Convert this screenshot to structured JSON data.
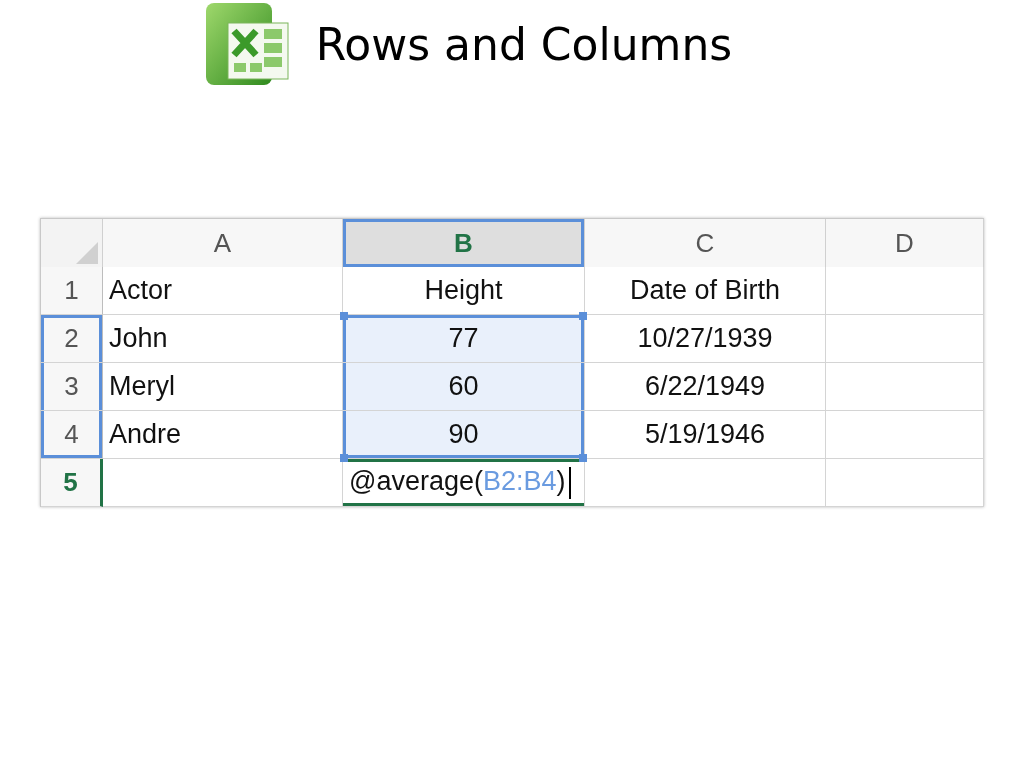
{
  "title": "Rows and Columns",
  "spreadsheet": {
    "columns": [
      {
        "label": "A",
        "selected": false
      },
      {
        "label": "B",
        "selected": true
      },
      {
        "label": "C",
        "selected": false
      },
      {
        "label": "D",
        "selected": false
      }
    ],
    "rows": [
      {
        "number": "1",
        "active": false,
        "outlined": false,
        "cells": [
          {
            "text": "Actor",
            "in_range": false
          },
          {
            "text": "Height",
            "in_range": false
          },
          {
            "text": "Date of Birth",
            "in_range": false
          },
          {
            "in_range": false
          }
        ]
      },
      {
        "number": "2",
        "active": false,
        "outlined": true,
        "cells": [
          {
            "text": "John",
            "in_range": false
          },
          {
            "text": "77",
            "in_range": true
          },
          {
            "text": "10/27/1939",
            "in_range": false
          },
          {
            "in_range": false
          }
        ]
      },
      {
        "number": "3",
        "active": false,
        "outlined": true,
        "cells": [
          {
            "text": "Meryl",
            "in_range": false
          },
          {
            "text": "60",
            "in_range": true
          },
          {
            "text": "6/22/1949",
            "in_range": false
          },
          {
            "in_range": false
          }
        ]
      },
      {
        "number": "4",
        "active": false,
        "outlined": true,
        "cells": [
          {
            "text": "Andre",
            "in_range": false
          },
          {
            "text": "90",
            "in_range": true
          },
          {
            "text": "5/19/1946",
            "in_range": false
          },
          {
            "in_range": false
          }
        ]
      },
      {
        "number": "5",
        "active": true,
        "outlined": false,
        "cells": [
          {
            "in_range": false
          },
          {
            "kind": "formula",
            "prefix": "@average(",
            "reference": "B2:B4",
            "suffix": ")",
            "in_range": false
          },
          {
            "in_range": false
          },
          {
            "in_range": false
          }
        ]
      }
    ]
  }
}
